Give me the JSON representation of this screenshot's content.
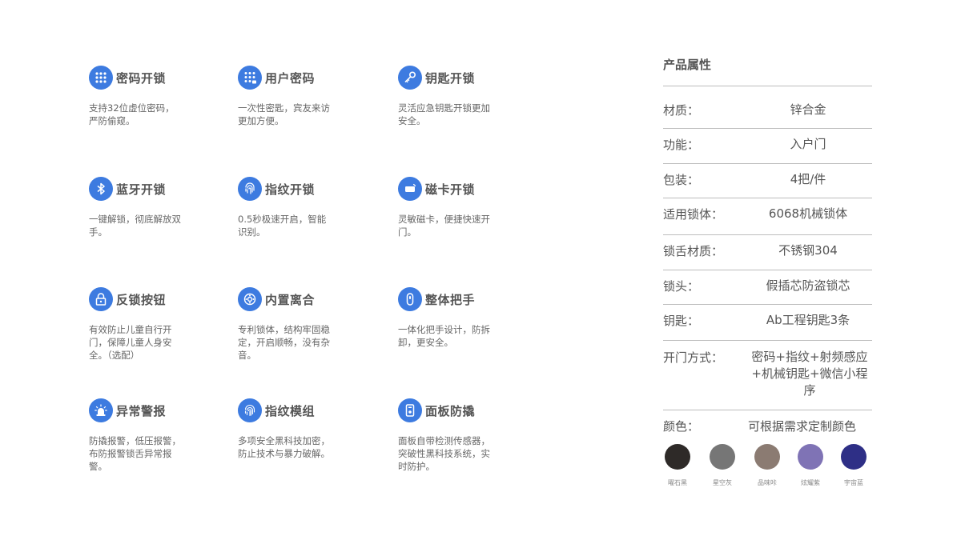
{
  "features": [
    {
      "icon": "keypad-icon",
      "title": "密码开锁",
      "desc": "支持32位虚位密码，严防偷窥。"
    },
    {
      "icon": "user-keypad-icon",
      "title": "用户密码",
      "desc": "一次性密匙，宾友来访更加方便。"
    },
    {
      "icon": "key-icon",
      "title": "钥匙开锁",
      "desc": "灵活应急钥匙开锁更加安全。"
    },
    {
      "icon": "bluetooth-icon",
      "title": "蓝牙开锁",
      "desc": "一键解锁，彻底解放双手。"
    },
    {
      "icon": "fingerprint-icon",
      "title": "指纹开锁",
      "desc": "0.5秒极速开启，智能识别。"
    },
    {
      "icon": "card-icon",
      "title": "磁卡开锁",
      "desc": "灵敏磁卡，便捷快速开门。"
    },
    {
      "icon": "padlock-icon",
      "title": "反锁按钮",
      "desc": "有效防止儿童自行开门，保障儿童人身安全。（选配）"
    },
    {
      "icon": "clutch-icon",
      "title": "内置离合",
      "desc": "专利锁体，结构牢固稳定，开启顺畅，没有杂音。"
    },
    {
      "icon": "handle-icon",
      "title": "整体把手",
      "desc": "一体化把手设计，防拆卸，更安全。"
    },
    {
      "icon": "alarm-icon",
      "title": "异常警报",
      "desc": "防撬报警，低压报警，布防报警锁舌异常报警。"
    },
    {
      "icon": "fingerprint-module-icon",
      "title": "指纹模组",
      "desc": "多项安全黑科技加密，防止技术与暴力破解。"
    },
    {
      "icon": "panel-icon",
      "title": "面板防撬",
      "desc": "面板自带检测传感器，突破性黑科技系统，实时防护。"
    }
  ],
  "attributes": {
    "title": "产品属性",
    "rows": [
      {
        "label": "材质：",
        "value": "锌合金"
      },
      {
        "label": "功能：",
        "value": "入户门"
      },
      {
        "label": "包装：",
        "value": "4把/件"
      },
      {
        "label": "适用锁体：",
        "value": "6068机械锁体"
      },
      {
        "label": "锁舌材质：",
        "value": "不锈钢304"
      },
      {
        "label": "锁头：",
        "value": "假插芯防盗锁芯"
      },
      {
        "label": "钥匙：",
        "value": "Ab工程钥匙3条"
      },
      {
        "label": "开门方式：",
        "value": "密码+指纹+射频感应+机械钥匙+微信小程序"
      }
    ],
    "colors": {
      "label": "颜色：",
      "value": "可根据需求定制颜色",
      "swatches": [
        {
          "name": "曜石黑",
          "hex": "#2e2a28"
        },
        {
          "name": "星空灰",
          "hex": "#767676"
        },
        {
          "name": "品味咔",
          "hex": "#8b7b72"
        },
        {
          "name": "炫耀紫",
          "hex": "#7f73b5"
        },
        {
          "name": "宇宙蓝",
          "hex": "#2e2f86"
        }
      ]
    }
  },
  "theme": {
    "accent": "#3d7be0"
  }
}
